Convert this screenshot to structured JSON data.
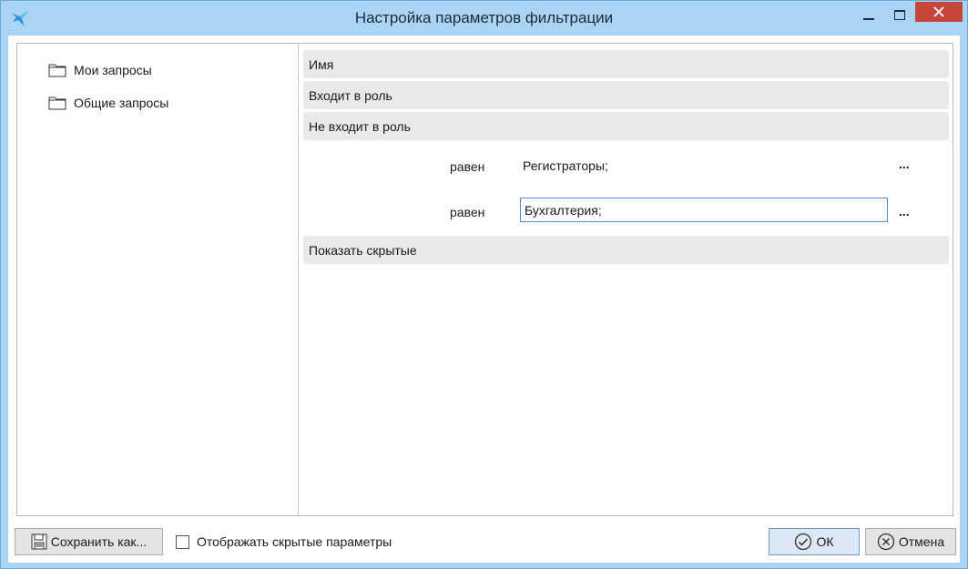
{
  "window": {
    "title": "Настройка параметров фильтрации",
    "accent": "#a9d4f5",
    "close_color": "#c7463c"
  },
  "tree": {
    "items": [
      {
        "label": "Мои запросы",
        "icon": "folder-icon"
      },
      {
        "label": "Общие запросы",
        "icon": "folder-icon"
      }
    ]
  },
  "filters": {
    "groups": [
      {
        "label": "Имя"
      },
      {
        "label": "Входит в роль"
      },
      {
        "label": "Не входит в роль"
      },
      {
        "label": "Показать скрытые"
      }
    ],
    "conditions": [
      {
        "operator": "равен",
        "value": "Регистраторы;",
        "browse": "..."
      },
      {
        "operator": "равен",
        "value": "Бухгалтерия;",
        "browse": "..."
      }
    ]
  },
  "footer": {
    "save_label": "Сохранить как...",
    "show_hidden_label": "Отображать скрытые параметры",
    "show_hidden_checked": false,
    "ok_label": "ОК",
    "cancel_label": "Отмена"
  }
}
